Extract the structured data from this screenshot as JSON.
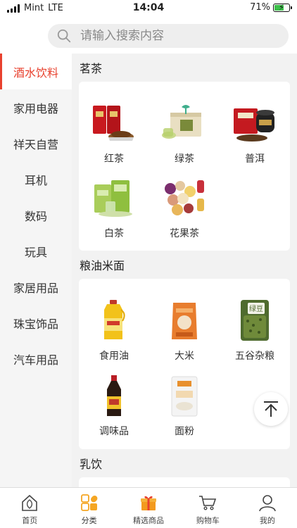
{
  "status": {
    "carrier": "Mint",
    "network": "LTE",
    "time": "14:04",
    "battery": "71%",
    "battery_level": 0.71
  },
  "search": {
    "placeholder": "请输入搜索内容"
  },
  "sidebar": {
    "items": [
      {
        "label": "酒水饮料",
        "active": true
      },
      {
        "label": "家用电器"
      },
      {
        "label": "祥天自营"
      },
      {
        "label": "耳机"
      },
      {
        "label": "数码"
      },
      {
        "label": "玩具"
      },
      {
        "label": "家居用品"
      },
      {
        "label": "珠宝饰品"
      },
      {
        "label": "汽车用品"
      }
    ]
  },
  "sections": [
    {
      "title": "茗茶",
      "items": [
        {
          "label": "红茶",
          "icon": "red-tea-icon"
        },
        {
          "label": "绿茶",
          "icon": "green-tea-icon"
        },
        {
          "label": "普洱",
          "icon": "puer-icon"
        },
        {
          "label": "白茶",
          "icon": "white-tea-icon"
        },
        {
          "label": "花果茶",
          "icon": "flower-tea-icon"
        }
      ]
    },
    {
      "title": "粮油米面",
      "items": [
        {
          "label": "食用油",
          "icon": "cooking-oil-icon"
        },
        {
          "label": "大米",
          "icon": "rice-icon"
        },
        {
          "label": "五谷杂粮",
          "icon": "grains-icon"
        },
        {
          "label": "调味品",
          "icon": "seasoning-icon"
        },
        {
          "label": "面粉",
          "icon": "flour-icon"
        }
      ]
    },
    {
      "title": "乳饮",
      "items": []
    }
  ],
  "grains_bag_text": "绿豆",
  "tabbar": {
    "tabs": [
      {
        "label": "首页",
        "icon": "home-icon"
      },
      {
        "label": "分类",
        "icon": "category-icon",
        "active": true
      },
      {
        "label": "精选商品",
        "icon": "gift-icon"
      },
      {
        "label": "购物车",
        "icon": "cart-icon"
      },
      {
        "label": "我的",
        "icon": "profile-icon"
      }
    ]
  },
  "colors": {
    "accent": "#e8412e",
    "tab_orange": "#f5a623",
    "sidebar_bg": "#f5f5f5",
    "content_bg": "#f2f2f2"
  }
}
